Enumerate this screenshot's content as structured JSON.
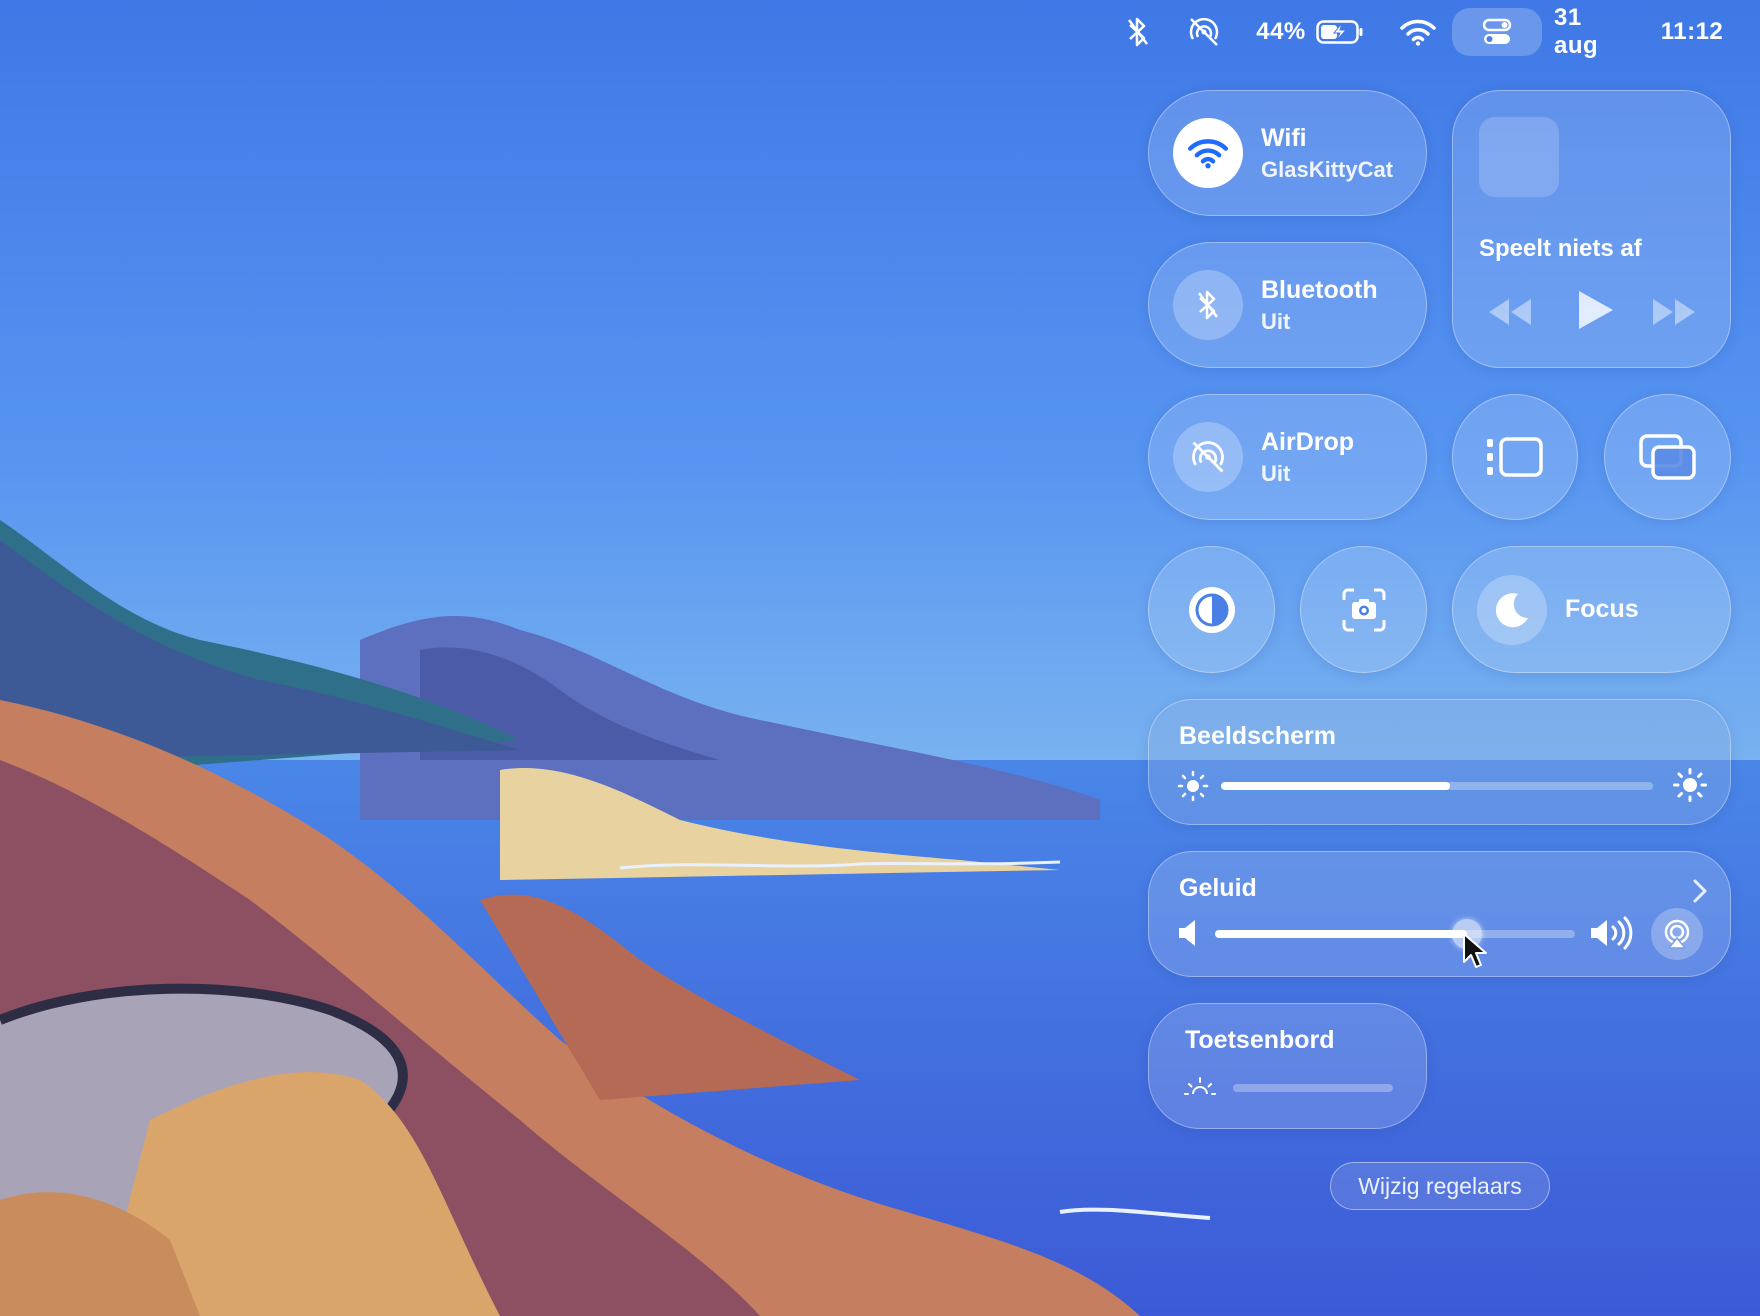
{
  "menubar": {
    "battery_percent": "44%",
    "date": "31 aug",
    "time": "11:12",
    "icons": [
      "bluetooth-off-icon",
      "airdrop-off-icon",
      "battery-charging-icon",
      "wifi-icon",
      "control-center-icon"
    ]
  },
  "control_center": {
    "wifi": {
      "title": "Wifi",
      "network": "GlasKittyCat",
      "state": "on"
    },
    "bluetooth": {
      "title": "Bluetooth",
      "status": "Uit"
    },
    "airdrop": {
      "title": "AirDrop",
      "status": "Uit"
    },
    "now_playing": {
      "label": "Speelt niets af"
    },
    "focus": {
      "label": "Focus"
    },
    "display": {
      "title": "Beeldscherm",
      "level": 0.53
    },
    "sound": {
      "title": "Geluid",
      "level": 0.7
    },
    "keyboard": {
      "title": "Toetsenbord",
      "level": 0
    },
    "edit_button": "Wijzig regelaars"
  },
  "colors": {
    "accent": "#1f6bff",
    "tile_bg": "rgba(255,255,255,0.16)"
  }
}
